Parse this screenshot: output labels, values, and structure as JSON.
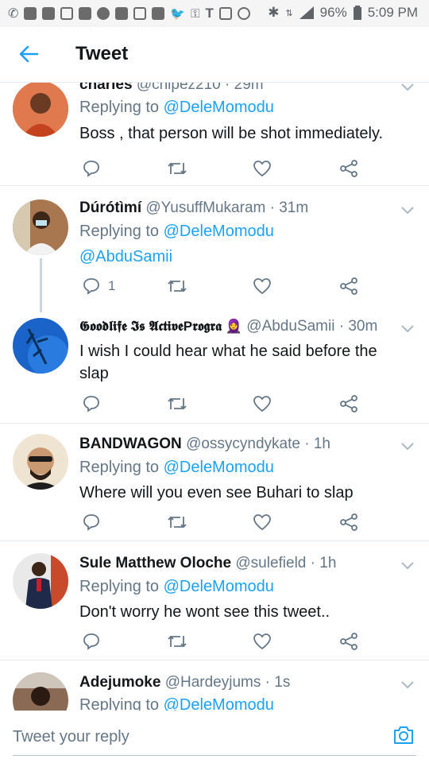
{
  "status_bar": {
    "battery": "96%",
    "time": "5:09 PM",
    "icons": [
      "phone-icon",
      "mail-icon",
      "email-icon",
      "cloud-icon",
      "chat-icon",
      "messenger-icon",
      "gmail-icon",
      "app-icon",
      "mail-alt-icon",
      "twitter-icon",
      "key-icon",
      "t-icon",
      "instagram-icon",
      "camera-icon",
      "bluetooth-icon",
      "data-icon",
      "signal-icon",
      "battery-icon"
    ]
  },
  "header": {
    "title": "Tweet",
    "back_icon": "back-arrow-icon"
  },
  "colors": {
    "accent": "#1da1f2",
    "text": "#14171a",
    "muted": "#657786",
    "divider": "#e6ecf0"
  },
  "tweets": [
    {
      "name": "charles",
      "handle": "@chipez210",
      "time": "· 29m",
      "replying_prefix": "Replying to",
      "replying_to": "@DeleMomodu",
      "text": "Boss , that person will be shot immediately.",
      "reply_count": "",
      "avatar_bg": "#c9522e"
    },
    {
      "name": "Dúrótìmí",
      "handle": "@YusuffMukaram",
      "time": "· 31m",
      "replying_prefix": "Replying to",
      "replying_to": "@DeleMomodu",
      "text": "@AbduSamii",
      "reply_count": "1",
      "avatar_bg": "#8b5a3c"
    },
    {
      "name": "𝕲𝖔𝖔𝖉𝖑𝖎𝖋𝖊 𝕴𝖘 𝕬𝖈𝖙𝖎𝖛𝖊P𝖗𝖔𝖌𝖗𝖆 🧕",
      "handle": "@AbduSamii",
      "time": "· 30m",
      "text": "I wish I could hear what he said before the slap",
      "reply_count": "",
      "avatar_bg": "#1e6fd0"
    },
    {
      "name": "BANDWAGON",
      "handle": "@ossycyndykate",
      "time": "· 1h",
      "replying_prefix": "Replying to",
      "replying_to": "@DeleMomodu",
      "text": "Where will you even see Buhari to slap",
      "reply_count": "",
      "avatar_bg": "#c8a27c"
    },
    {
      "name": "Sule Matthew Oloche",
      "handle": "@sulefield",
      "time": "· 1h",
      "replying_prefix": "Replying to",
      "replying_to": "@DeleMomodu",
      "text": "Don't worry he wont see this tweet..",
      "reply_count": "",
      "avatar_bg": "#3a3a3a"
    },
    {
      "name": "Adejumoke",
      "handle": "@Hardeyjums",
      "time": "· 1s",
      "replying_prefix": "Replying to",
      "replying_to": "@DeleMomodu",
      "avatar_bg": "#7a4e3a"
    }
  ],
  "composer": {
    "placeholder": "Tweet your reply",
    "camera_icon": "camera-icon"
  }
}
